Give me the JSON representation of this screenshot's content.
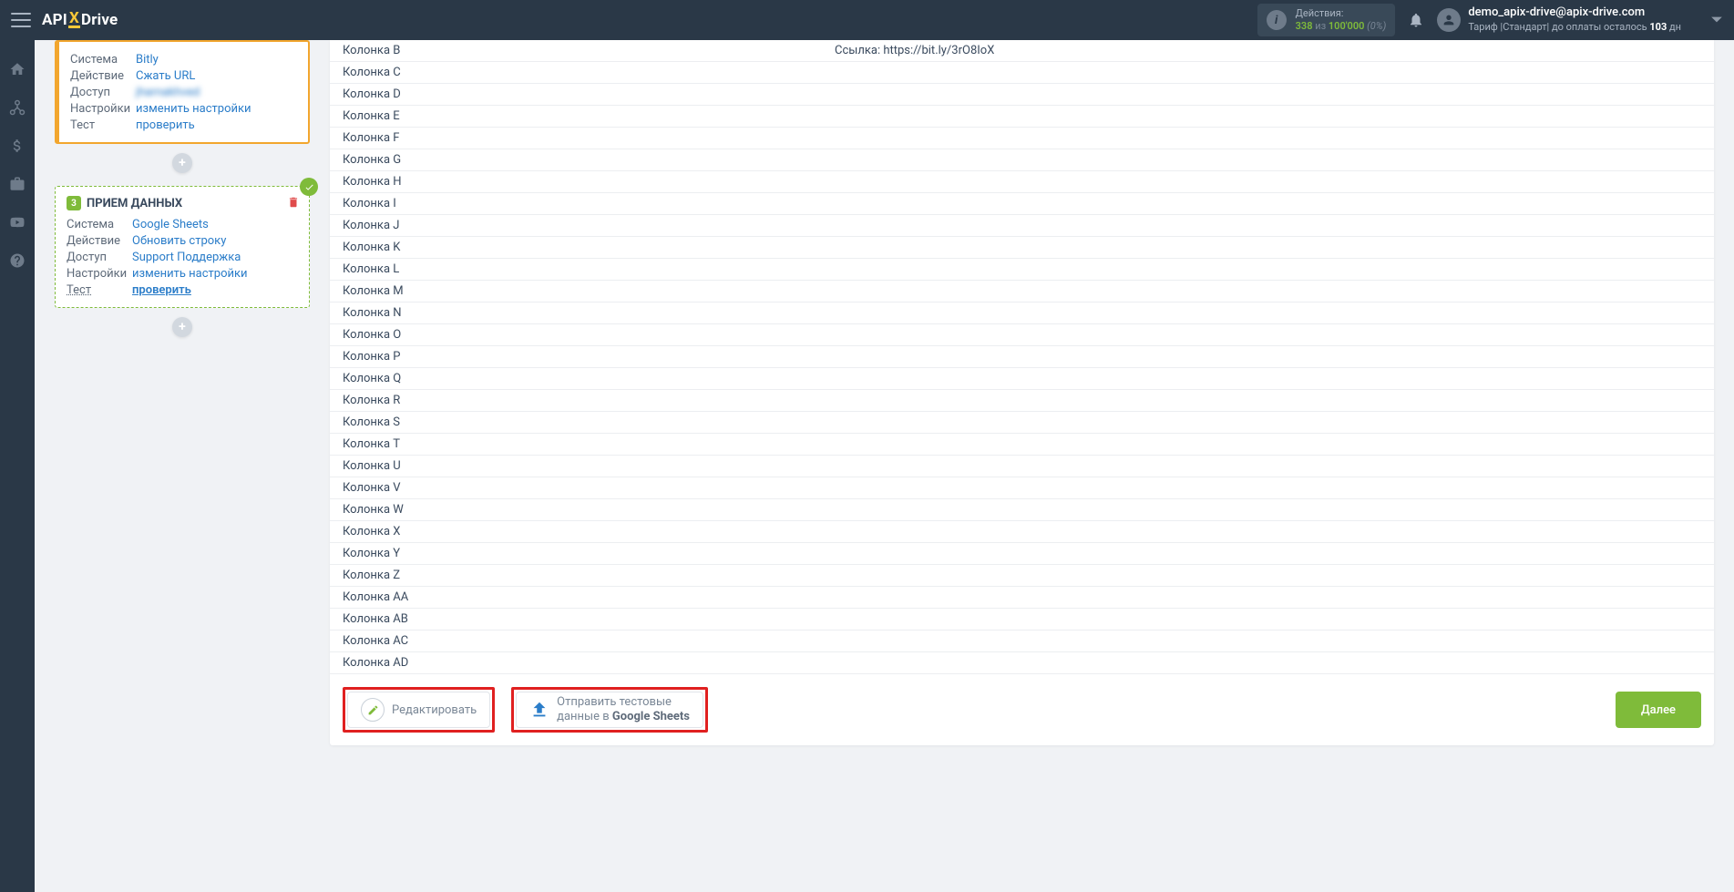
{
  "header": {
    "logo": {
      "part1": "API",
      "part2": "X",
      "part3": "Drive"
    },
    "actions": {
      "label": "Действия:",
      "used": "338",
      "of_word": "из",
      "limit": "100'000",
      "percent": "(0%)"
    },
    "user": {
      "email": "demo_apix-drive@apix-drive.com",
      "plan_prefix": "Тариф |Стандарт| до оплаты осталось ",
      "plan_days": "103",
      "plan_suffix": " дн"
    }
  },
  "cards": {
    "block1": {
      "rows": [
        {
          "label": "Система",
          "value": "Bitly",
          "link": true
        },
        {
          "label": "Действие",
          "value": "Сжать URL",
          "link": true
        },
        {
          "label": "Доступ",
          "value": "jharnakhved",
          "blur": true
        },
        {
          "label": "Настройки",
          "value": "изменить настройки",
          "link": true
        },
        {
          "label": "Тест",
          "value": "проверить",
          "link": true
        }
      ]
    },
    "block2": {
      "badge": "3",
      "title": "ПРИЕМ ДАННЫХ",
      "rows": [
        {
          "label": "Система",
          "value": "Google Sheets",
          "link": true
        },
        {
          "label": "Действие",
          "value": "Обновить строку",
          "link": true
        },
        {
          "label": "Доступ",
          "value": "Support Поддержка",
          "link": true
        },
        {
          "label": "Настройки",
          "value": "изменить настройки",
          "link": true
        },
        {
          "label": "Тест",
          "value": "проверить",
          "link": true,
          "underline": true,
          "label_underline": true
        }
      ]
    }
  },
  "table": {
    "rows": [
      {
        "key": "Колонка B",
        "val": "Ссылка: https://bit.ly/3rO8IoX"
      },
      {
        "key": "Колонка C",
        "val": ""
      },
      {
        "key": "Колонка D",
        "val": ""
      },
      {
        "key": "Колонка E",
        "val": ""
      },
      {
        "key": "Колонка F",
        "val": ""
      },
      {
        "key": "Колонка G",
        "val": ""
      },
      {
        "key": "Колонка H",
        "val": ""
      },
      {
        "key": "Колонка I",
        "val": ""
      },
      {
        "key": "Колонка J",
        "val": ""
      },
      {
        "key": "Колонка K",
        "val": ""
      },
      {
        "key": "Колонка L",
        "val": ""
      },
      {
        "key": "Колонка M",
        "val": ""
      },
      {
        "key": "Колонка N",
        "val": ""
      },
      {
        "key": "Колонка O",
        "val": ""
      },
      {
        "key": "Колонка P",
        "val": ""
      },
      {
        "key": "Колонка Q",
        "val": ""
      },
      {
        "key": "Колонка R",
        "val": ""
      },
      {
        "key": "Колонка S",
        "val": ""
      },
      {
        "key": "Колонка T",
        "val": ""
      },
      {
        "key": "Колонка U",
        "val": ""
      },
      {
        "key": "Колонка V",
        "val": ""
      },
      {
        "key": "Колонка W",
        "val": ""
      },
      {
        "key": "Колонка X",
        "val": ""
      },
      {
        "key": "Колонка Y",
        "val": ""
      },
      {
        "key": "Колонка Z",
        "val": ""
      },
      {
        "key": "Колонка AA",
        "val": ""
      },
      {
        "key": "Колонка AB",
        "val": ""
      },
      {
        "key": "Колонка AC",
        "val": ""
      },
      {
        "key": "Колонка AD",
        "val": ""
      }
    ]
  },
  "footer": {
    "edit": "Редактировать",
    "upload_line1": "Отправить тестовые",
    "upload_line2_prefix": "данные в ",
    "upload_line2_strong": "Google Sheets",
    "next": "Далее"
  }
}
